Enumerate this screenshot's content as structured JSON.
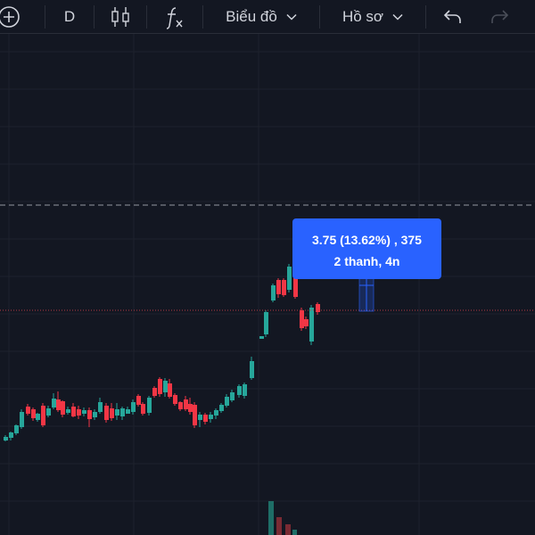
{
  "toolbar": {
    "interval_label": "D",
    "chart_menu_label": "Biểu đồ",
    "profile_menu_label": "Hồ sơ",
    "icons": [
      "add-circle-icon",
      "candlestick-icon",
      "function-icon",
      "chevron-down-icon",
      "undo-icon",
      "redo-icon"
    ]
  },
  "tooltip": {
    "line1": "3.75 (13.62%) , 375",
    "line2": "2 thanh, 4n"
  },
  "colors": {
    "background": "#131722",
    "up": "#26a69a",
    "down": "#f23645",
    "accent": "#2962ff",
    "range_box": "#9c27b0"
  }
}
